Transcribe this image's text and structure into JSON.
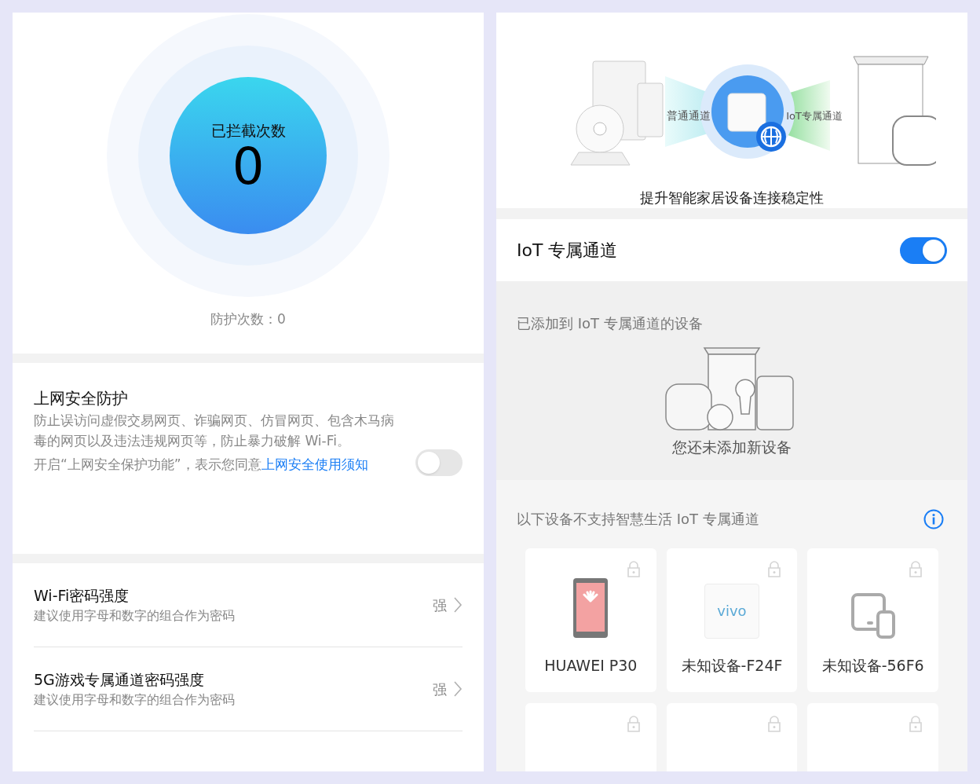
{
  "protection": {
    "title": "已拦截次数",
    "count": "0",
    "summary": "防护次数：0"
  },
  "web_security": {
    "title": "上网安全防护",
    "description": "防止误访问虚假交易网页、诈骗网页、仿冒网页、包含木马病毒的网页以及违法违规网页等，防止暴力破解 Wi-Fi。",
    "notice": "开启“上网安全保护功能”，表示您同意",
    "link": "上网安全使用须知",
    "on": false
  },
  "password_rows": [
    {
      "title": "Wi-Fi密码强度",
      "subtitle": "建议使用字母和数字的组合作为密码",
      "value": "强"
    },
    {
      "title": "5G游戏专属通道密码强度",
      "subtitle": "建议使用字母和数字的组合作为密码",
      "value": "强"
    }
  ],
  "iot": {
    "banner": {
      "normal_label": "普通通道",
      "iot_label": "IoT专属通道",
      "caption": "提升智能家居设备连接稳定性"
    },
    "toggle": {
      "label": "IoT 专属通道",
      "on": true
    },
    "added": {
      "title": "已添加到 IoT 专属通道的设备",
      "empty_text": "您还未添加新设备"
    },
    "unsupported": {
      "title": "以下设备不支持智慧生活 IoT 专属通道",
      "devices": [
        {
          "kind": "phone",
          "name": "HUAWEI P30",
          "locked": true
        },
        {
          "kind": "logo",
          "name": "未知设备-F24F",
          "logo_text": "vivo",
          "locked": true
        },
        {
          "kind": "generic",
          "name": "未知设备-56F6",
          "locked": true
        },
        {
          "kind": "cut",
          "locked": true
        },
        {
          "kind": "cut",
          "locked": true
        },
        {
          "kind": "cut",
          "locked": true
        }
      ]
    }
  }
}
